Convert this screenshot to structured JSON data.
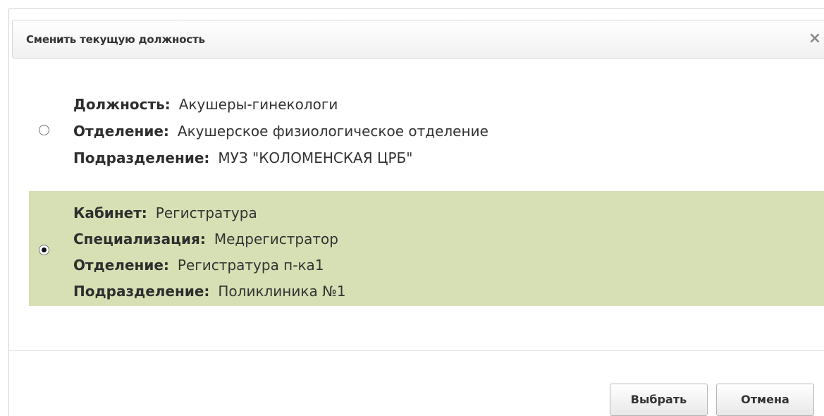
{
  "dialog": {
    "title": "Сменить текущую должность",
    "close_icon": "×"
  },
  "options": [
    {
      "selected": false,
      "fields": [
        {
          "label": "Должность:",
          "value": "Акушеры-гинекологи"
        },
        {
          "label": "Отделение:",
          "value": "Акушерское физиологическое отделение"
        },
        {
          "label": "Подразделение:",
          "value": "МУЗ \"КОЛОМЕНСКАЯ ЦРБ\""
        }
      ]
    },
    {
      "selected": true,
      "fields": [
        {
          "label": "Кабинет:",
          "value": "Регистратура"
        },
        {
          "label": "Специализация:",
          "value": "Медрегистратор"
        },
        {
          "label": "Отделение:",
          "value": "Регистратура п-ка1"
        },
        {
          "label": "Подразделение:",
          "value": "Поликлиника №1"
        }
      ]
    }
  ],
  "buttons": {
    "select_label": "Выбрать",
    "cancel_label": "Отмена"
  },
  "colors": {
    "selected_row_bg": "#d6e0b4",
    "header_text": "#333333"
  }
}
